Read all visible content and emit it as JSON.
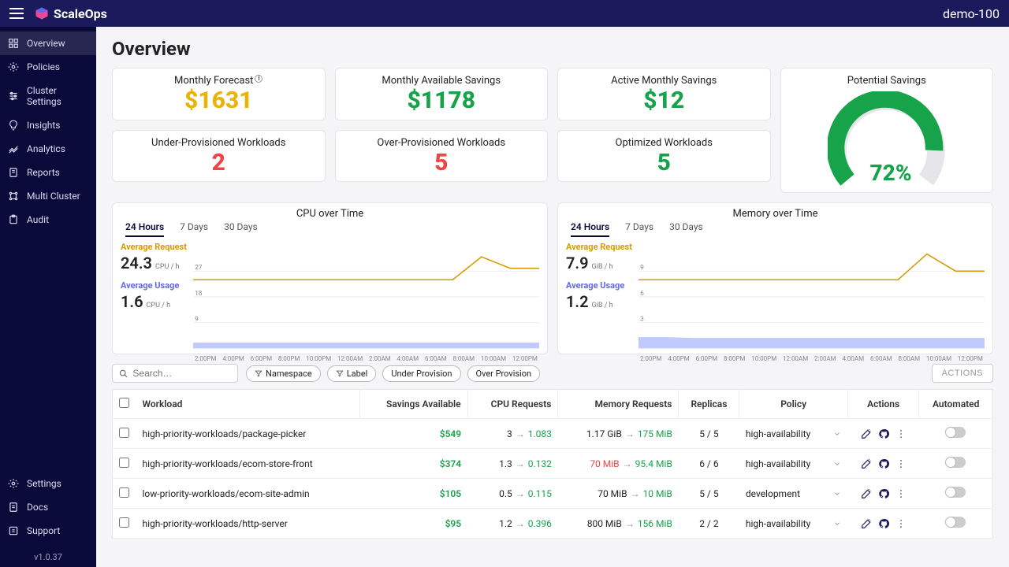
{
  "topbar": {
    "brand": "ScaleOps",
    "cluster": "demo-100"
  },
  "sidebar": {
    "items": [
      {
        "label": "Overview",
        "icon": "grid"
      },
      {
        "label": "Policies",
        "icon": "gear"
      },
      {
        "label": "Cluster Settings",
        "icon": "sliders"
      },
      {
        "label": "Insights",
        "icon": "bulb"
      },
      {
        "label": "Analytics",
        "icon": "analytics"
      },
      {
        "label": "Reports",
        "icon": "report"
      },
      {
        "label": "Multi Cluster",
        "icon": "multi"
      },
      {
        "label": "Audit",
        "icon": "audit"
      }
    ],
    "bottom": [
      {
        "label": "Settings",
        "icon": "gear"
      },
      {
        "label": "Docs",
        "icon": "docs"
      },
      {
        "label": "Support",
        "icon": "support"
      }
    ],
    "version": "v1.0.37"
  },
  "page_title": "Overview",
  "kpis": {
    "forecast": {
      "title": "Monthly Forecast",
      "value": "$1631"
    },
    "available": {
      "title": "Monthly Available Savings",
      "value": "$1178"
    },
    "active": {
      "title": "Active Monthly Savings",
      "value": "$12"
    },
    "under": {
      "title": "Under-Provisioned Workloads",
      "value": "2"
    },
    "over": {
      "title": "Over-Provisioned Workloads",
      "value": "5"
    },
    "optimized": {
      "title": "Optimized Workloads",
      "value": "5"
    },
    "potential": {
      "title": "Potential Savings",
      "pct": "72%"
    }
  },
  "charts": {
    "tabs": [
      "24 Hours",
      "7 Days",
      "30 Days"
    ],
    "cpu": {
      "title": "CPU over Time",
      "avg_request": {
        "label": "Average Request",
        "value": "24.3",
        "unit": "CPU / h"
      },
      "avg_usage": {
        "label": "Average Usage",
        "value": "1.6",
        "unit": "CPU / h"
      }
    },
    "memory": {
      "title": "Memory over Time",
      "avg_request": {
        "label": "Average Request",
        "value": "7.9",
        "unit": "GiB / h"
      },
      "avg_usage": {
        "label": "Average Usage",
        "value": "1.2",
        "unit": "GiB / h"
      }
    },
    "x_ticks": [
      "2:00PM",
      "4:00PM",
      "6:00PM",
      "8:00PM",
      "10:00PM",
      "12:00AM",
      "2:00AM",
      "4:00AM",
      "6:00AM",
      "8:00AM",
      "10:00AM",
      "12:00PM"
    ]
  },
  "toolbar": {
    "search_placeholder": "Search…",
    "filters": [
      "Namespace",
      "Label",
      "Under Provision",
      "Over Provision"
    ],
    "actions_label": "ACTIONS"
  },
  "table": {
    "headers": {
      "workload": "Workload",
      "savings": "Savings Available",
      "cpu": "CPU Requests",
      "memory": "Memory Requests",
      "replicas": "Replicas",
      "policy": "Policy",
      "actions": "Actions",
      "automated": "Automated"
    },
    "rows": [
      {
        "workload": "high-priority-workloads/package-picker",
        "savings": "$549",
        "cpu_from": "3",
        "cpu_to": "1.083",
        "cpu_dir": "green",
        "mem_from": "1.17 GiB",
        "mem_to": "175 MiB",
        "mem_dir": "green",
        "replicas": "5 / 5",
        "policy": "high-availability"
      },
      {
        "workload": "high-priority-workloads/ecom-store-front",
        "savings": "$374",
        "cpu_from": "1.3",
        "cpu_to": "0.132",
        "cpu_dir": "green",
        "mem_from": "70 MiB",
        "mem_to": "95.4 MiB",
        "mem_dir": "red_from",
        "replicas": "6 / 6",
        "policy": "high-availability"
      },
      {
        "workload": "low-priority-workloads/ecom-site-admin",
        "savings": "$105",
        "cpu_from": "0.5",
        "cpu_to": "0.115",
        "cpu_dir": "green",
        "mem_from": "70 MiB",
        "mem_to": "10 MiB",
        "mem_dir": "green",
        "replicas": "5 / 5",
        "policy": "development"
      },
      {
        "workload": "high-priority-workloads/http-server",
        "savings": "$95",
        "cpu_from": "1.2",
        "cpu_to": "0.396",
        "cpu_dir": "green",
        "mem_from": "800 MiB",
        "mem_to": "156 MiB",
        "mem_dir": "green",
        "replicas": "2 / 2",
        "policy": "high-availability"
      }
    ]
  },
  "chart_data": [
    {
      "type": "line",
      "title": "CPU over Time",
      "xlabel": "",
      "ylabel": "CPU",
      "ylim": [
        0,
        36
      ],
      "x_ticks": [
        "2:00PM",
        "4:00PM",
        "6:00PM",
        "8:00PM",
        "10:00PM",
        "12:00AM",
        "2:00AM",
        "4:00AM",
        "6:00AM",
        "8:00AM",
        "10:00AM",
        "12:00PM"
      ],
      "series": [
        {
          "name": "Average Request",
          "color": "#d69b00",
          "values": [
            24,
            24,
            24,
            24,
            24,
            24,
            24,
            24,
            24,
            24,
            32,
            28,
            28
          ]
        },
        {
          "name": "Average Usage",
          "color": "#6366f1",
          "values": [
            2,
            2,
            2,
            2,
            2,
            2,
            2,
            2,
            2,
            2,
            2,
            2,
            2
          ]
        }
      ]
    },
    {
      "type": "line",
      "title": "Memory over Time",
      "xlabel": "",
      "ylabel": "GiB",
      "ylim": [
        0,
        12
      ],
      "x_ticks": [
        "2:00PM",
        "4:00PM",
        "6:00PM",
        "8:00PM",
        "10:00PM",
        "12:00AM",
        "2:00AM",
        "4:00AM",
        "6:00AM",
        "8:00AM",
        "10:00AM",
        "12:00PM"
      ],
      "series": [
        {
          "name": "Average Request",
          "color": "#d69b00",
          "values": [
            8,
            8,
            8,
            8,
            8,
            8,
            8,
            8,
            8,
            8,
            11,
            9,
            9
          ]
        },
        {
          "name": "Average Usage",
          "color": "#6366f1",
          "values": [
            1.3,
            1.3,
            1.2,
            1.2,
            1.2,
            1.2,
            1.2,
            1.2,
            1.2,
            1.2,
            1.2,
            1.2,
            1.2
          ]
        }
      ]
    }
  ]
}
